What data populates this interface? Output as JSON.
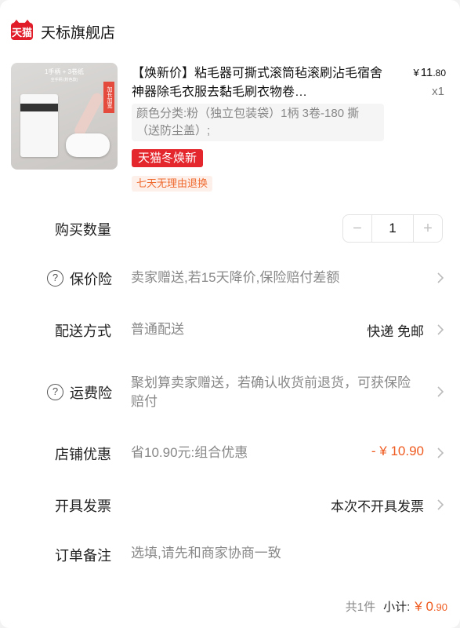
{
  "store": {
    "badge": "天猫",
    "name": "天标旗舰店"
  },
  "product": {
    "image_texts": {
      "top": "1手柄 + 3卷纸",
      "sub": "全手柄 (粉色款)",
      "tag": "加长加宽"
    },
    "title": "【焕新价】粘毛器可撕式滚筒毡滚刷沾毛宿舍神器除毛衣服去黏毛刷衣物卷…",
    "price_symbol": "¥",
    "price_int": "11",
    "price_dec": ".80",
    "quantity_label": "x1",
    "spec": "颜色分类:粉（独立包装袋）1柄 3卷-180 撕（送防尘盖）;",
    "promo_tag": "天猫冬焕新",
    "return_tag": "七天无理由退换"
  },
  "order": {
    "quantity": {
      "label": "购买数量",
      "minus": "−",
      "value": "1",
      "plus": "+"
    },
    "price_protection": {
      "icon": "?",
      "label": "保价险",
      "value": "卖家赠送,若15天降价,保险赔付差额"
    },
    "delivery": {
      "label": "配送方式",
      "value": "普通配送",
      "right": "快递 免邮"
    },
    "shipping_insurance": {
      "icon": "?",
      "label": "运费险",
      "value": "聚划算卖家赠送，若确认收货前退货，可获保险赔付"
    },
    "store_discount": {
      "label": "店铺优惠",
      "value": "省10.90元:组合优惠",
      "right": "- ¥ 10.90"
    },
    "invoice": {
      "label": "开具发票",
      "right": "本次不开具发票"
    },
    "note": {
      "label": "订单备注",
      "placeholder": "选填,请先和商家协商一致"
    },
    "subtotal": {
      "count": "共1件",
      "label": "小计:",
      "symbol": "¥",
      "int": "0",
      "dec": ".90"
    }
  },
  "colors": {
    "brand_red": "#e4262d",
    "discount_orange": "#ef5a1f"
  }
}
